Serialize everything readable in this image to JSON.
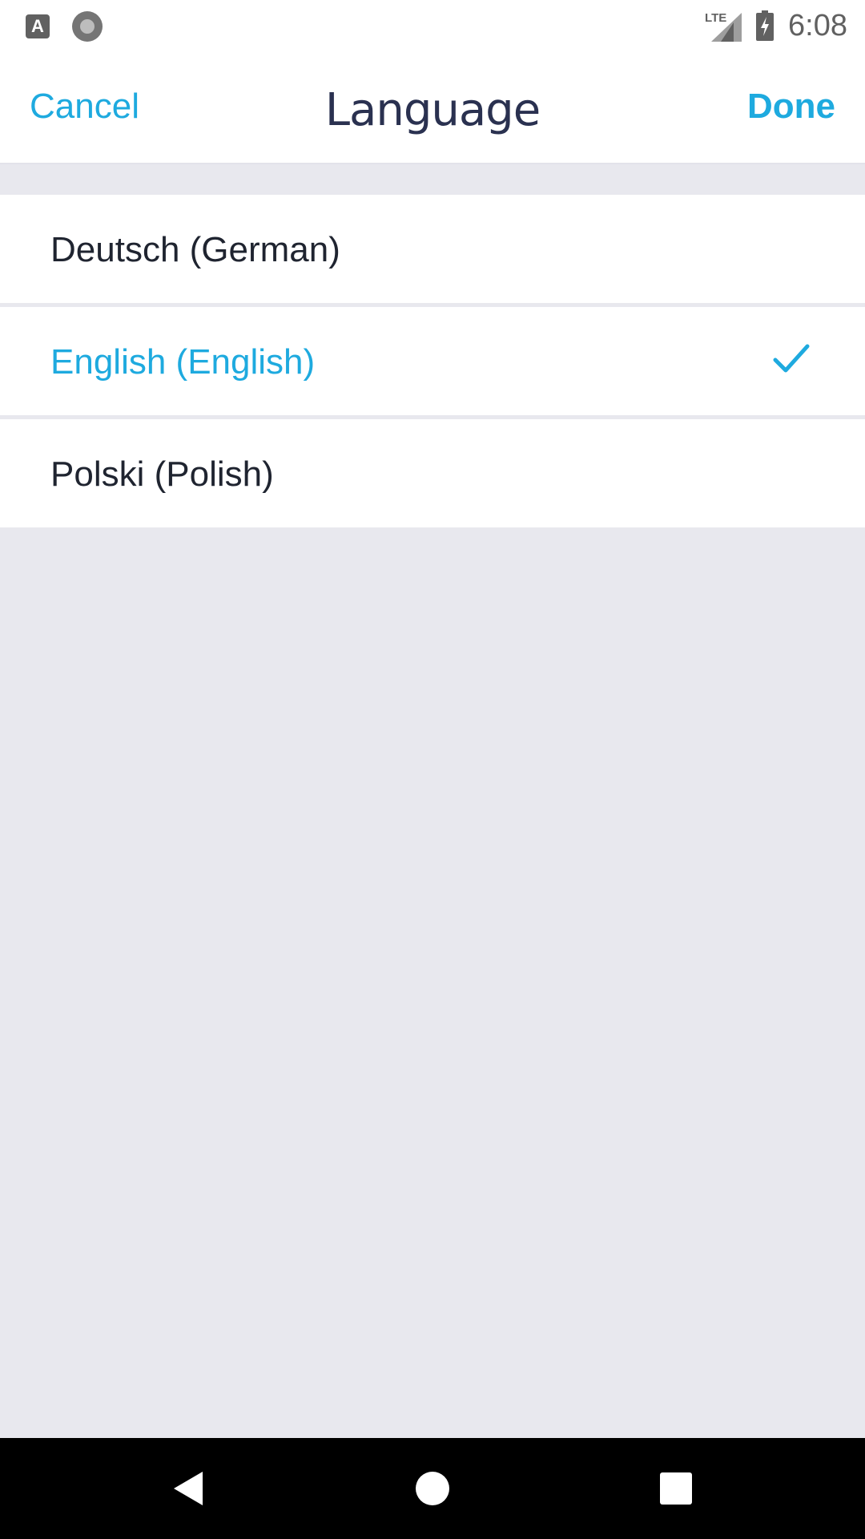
{
  "status_bar": {
    "left_icons": [
      "text-a-icon",
      "record-circle-icon"
    ],
    "network_label": "LTE",
    "time": "6:08"
  },
  "header": {
    "cancel_label": "Cancel",
    "title": "Language",
    "done_label": "Done"
  },
  "languages": [
    {
      "label": "Deutsch (German)",
      "selected": false
    },
    {
      "label": "English (English)",
      "selected": true
    },
    {
      "label": "Polski (Polish)",
      "selected": false
    }
  ],
  "colors": {
    "accent": "#1eaadf",
    "title": "#2a3150",
    "text": "#1f2430",
    "background": "#e8e8ee",
    "row": "#ffffff"
  },
  "nav_bar": {
    "buttons": [
      "back-icon",
      "home-icon",
      "recent-apps-icon"
    ]
  }
}
